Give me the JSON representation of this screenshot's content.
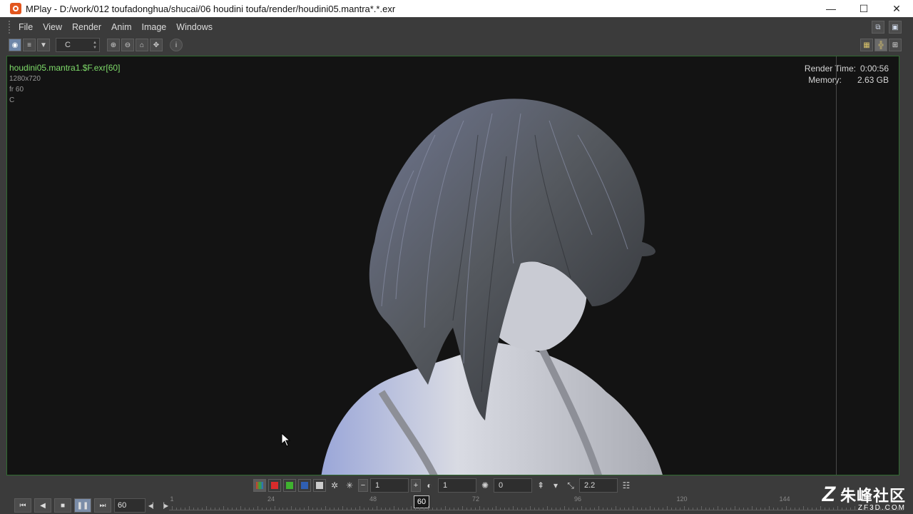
{
  "window": {
    "title": "MPlay - D:/work/012 toufadonghua/shucai/06 houdini toufa/render/houdini05.mantra*.*.exr",
    "controls": {
      "minimize": "—",
      "maximize": "☐",
      "close": "✕"
    }
  },
  "menu": {
    "items": [
      "File",
      "View",
      "Render",
      "Anim",
      "Image",
      "Windows"
    ]
  },
  "toolbar": {
    "plane": "C"
  },
  "viewport": {
    "image_name": "houdini05.mantra1.$F.exr[60]",
    "resolution": "1280x720",
    "frame_label": "fr 60",
    "plane_label": "C",
    "render_time_label": "Render Time:",
    "render_time_value": "0:00:56",
    "memory_label": "Memory:",
    "memory_value": "2.63 GB"
  },
  "adjust": {
    "channel_value": "1",
    "gamma_like_value": "1",
    "exposure_value": "0",
    "gamma_value": "2.2"
  },
  "playbar": {
    "current_frame": "60",
    "timeline_current": "60",
    "ticks": [
      "1",
      "24",
      "48",
      "72",
      "96",
      "120",
      "144"
    ]
  },
  "watermark": {
    "logo": "Z",
    "name": "朱峰社区",
    "url": "ZF3D.COM"
  },
  "colors": {
    "viewport_border": "#2f6b2f",
    "image_name": "#7fdc6a"
  }
}
